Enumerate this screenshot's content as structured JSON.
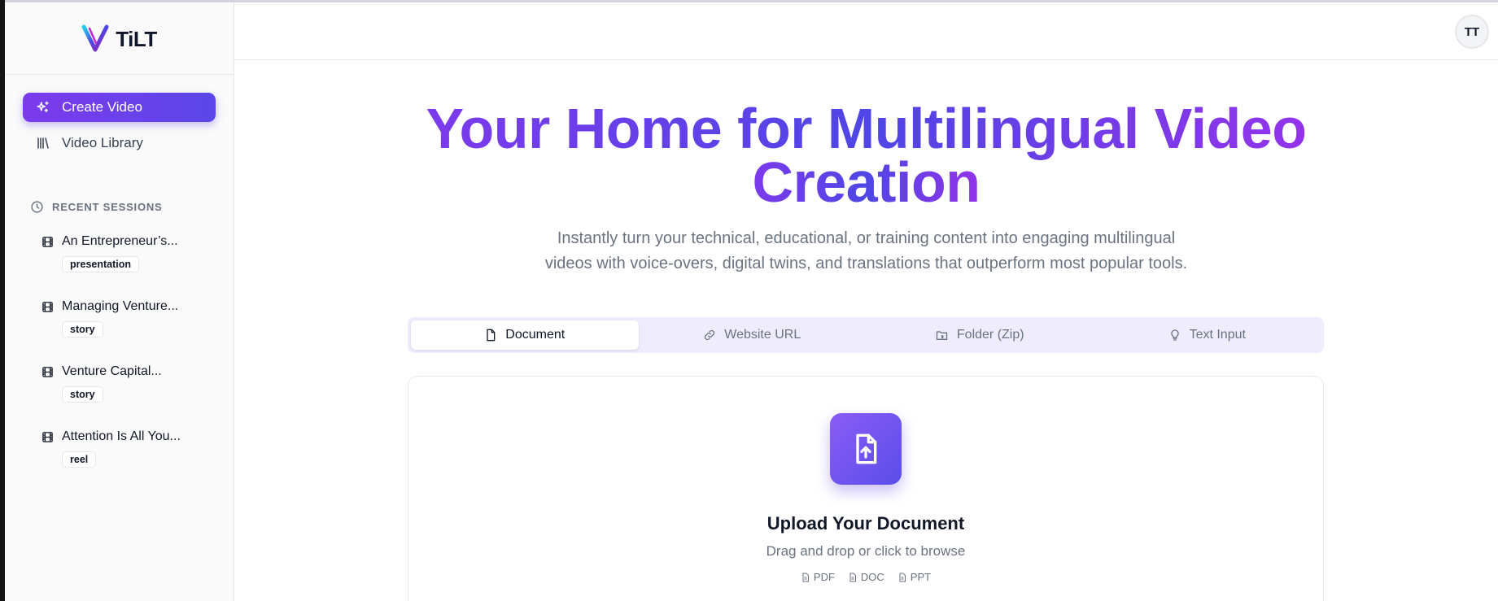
{
  "app": {
    "brand": "TiLT"
  },
  "sidebar": {
    "nav": [
      {
        "label": "Create Video",
        "icon": "sparkles-icon",
        "active": true
      },
      {
        "label": "Video Library",
        "icon": "library-icon",
        "active": false
      }
    ],
    "recent_title": "RECENT SESSIONS",
    "sessions": [
      {
        "name": "An Entrepreneur’s...",
        "tag": "presentation"
      },
      {
        "name": "Managing Venture...",
        "tag": "story"
      },
      {
        "name": "Venture Capital...",
        "tag": "story"
      },
      {
        "name": "Attention Is All You...",
        "tag": "reel"
      }
    ]
  },
  "header": {
    "avatar_initials": "TT"
  },
  "hero": {
    "title_line1": "Your Home for Multilingual Video",
    "title_line2": "Creation",
    "subtitle_line1": "Instantly turn your technical, educational, or training content into engaging multilingual",
    "subtitle_line2": "videos with voice-overs, digital twins, and translations that outperform most popular tools."
  },
  "tabs": [
    {
      "label": "Document",
      "icon": "document-icon",
      "active": true
    },
    {
      "label": "Website URL",
      "icon": "link-icon",
      "active": false
    },
    {
      "label": "Folder (Zip)",
      "icon": "folder-zip-icon",
      "active": false
    },
    {
      "label": "Text Input",
      "icon": "lightbulb-icon",
      "active": false
    }
  ],
  "upload": {
    "title": "Upload Your Document",
    "subtitle": "Drag and drop or click to browse",
    "formats": [
      "PDF",
      "DOC",
      "PPT"
    ]
  },
  "colors": {
    "accent": "#6d3fe8",
    "accent_gradient_start": "#7c3aed",
    "accent_gradient_end": "#4f46e5",
    "tab_bg": "#efedfd"
  }
}
